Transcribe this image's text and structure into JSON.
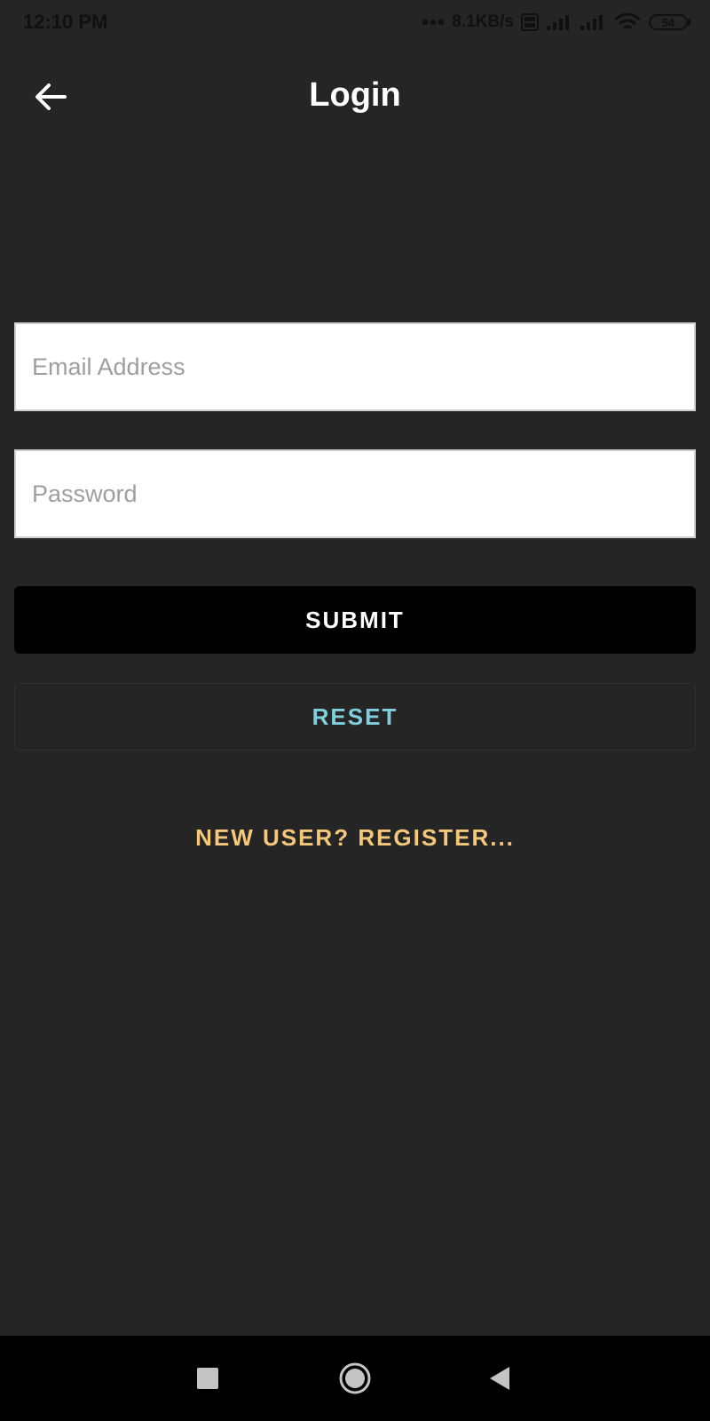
{
  "status_bar": {
    "time": "12:10 PM",
    "network_speed": "8.1KB/s",
    "battery_level": "54"
  },
  "app_bar": {
    "title": "Login",
    "back_icon": "arrow-left-icon"
  },
  "form": {
    "email_placeholder": "Email Address",
    "email_value": "",
    "password_placeholder": "Password",
    "password_value": "",
    "submit_label": "SUBMIT",
    "reset_label": "RESET",
    "register_label": "NEW USER? REGISTER..."
  },
  "nav_bar": {
    "recents_icon": "square-icon",
    "home_icon": "circle-icon",
    "back_icon": "triangle-back-icon"
  },
  "colors": {
    "background": "#252525",
    "submit_bg": "#000000",
    "reset_text": "#7fd0dc",
    "register_text": "#f5c77a",
    "nav_bar_bg": "#000000"
  }
}
